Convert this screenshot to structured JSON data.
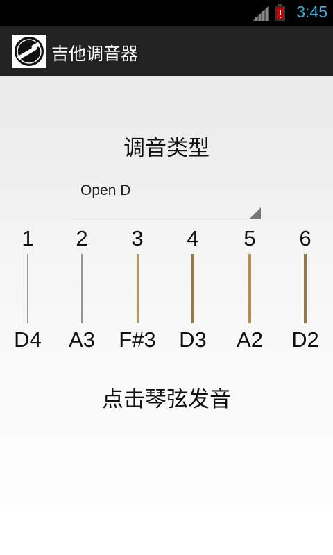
{
  "status_bar": {
    "time": "3:45",
    "signal_icon": "signal-icon",
    "battery_icon": "battery-icon"
  },
  "action_bar": {
    "title": "吉他调音器",
    "logo_icon": "guitar-logo-icon"
  },
  "main": {
    "tuning_label": "调音类型",
    "tuning_select": {
      "value": "Open D"
    },
    "strings": [
      {
        "number": "1",
        "note": "D4"
      },
      {
        "number": "2",
        "note": "A3"
      },
      {
        "number": "3",
        "note": "F#3"
      },
      {
        "number": "4",
        "note": "D3"
      },
      {
        "number": "5",
        "note": "A2"
      },
      {
        "number": "6",
        "note": "D2"
      }
    ],
    "play_hint": "点击琴弦发音"
  },
  "colors": {
    "status_time": "#33b5e5",
    "action_bar": "#222222",
    "battery_alert": "#cc0000"
  }
}
